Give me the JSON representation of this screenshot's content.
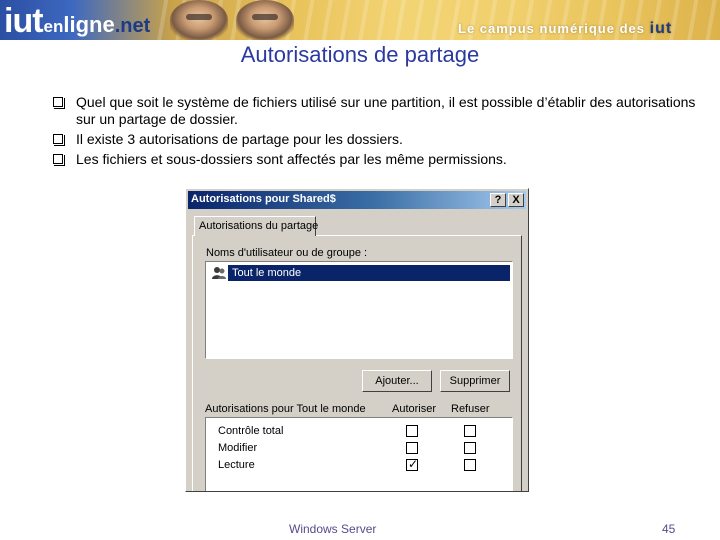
{
  "banner": {
    "logo_iut": "iut",
    "logo_en": "en",
    "logo_ligne": "ligne",
    "logo_net": ".net",
    "tagline": "Le campus numérique des",
    "tagline_iut": "iut",
    "colors": {
      "blue": "#2b4fa3",
      "gold": "#e8c25a"
    }
  },
  "slide": {
    "title": "Autorisations de partage",
    "title_color": "#2b3aa0",
    "bullets": [
      "Quel que soit le système de fichiers utilisé sur une partition, il est possible d’établir des autorisations sur un partage de dossier.",
      "Il existe 3 autorisations de partage pour les dossiers.",
      "Les fichiers et sous-dossiers sont affectés par les même permissions."
    ]
  },
  "dialog": {
    "title": "Autorisations pour Shared$",
    "help_button": "?",
    "close_button": "X",
    "tab_label": "Autorisations du partage",
    "users_label": "Noms d'utilisateur ou de groupe :",
    "users": [
      {
        "name": "Tout le monde",
        "icon": "group-icon",
        "selected": true
      }
    ],
    "add_button": "Ajouter...",
    "remove_button": "Supprimer",
    "permissions_label": "Autorisations pour Tout le monde",
    "allow_header": "Autoriser",
    "deny_header": "Refuser",
    "permissions": [
      {
        "name": "Contrôle total",
        "allow": false,
        "deny": false
      },
      {
        "name": "Modifier",
        "allow": false,
        "deny": false
      },
      {
        "name": "Lecture",
        "allow": true,
        "deny": false
      }
    ],
    "selection_color": "#0a246a"
  },
  "footer": {
    "text": "Windows Server",
    "page": "45"
  }
}
